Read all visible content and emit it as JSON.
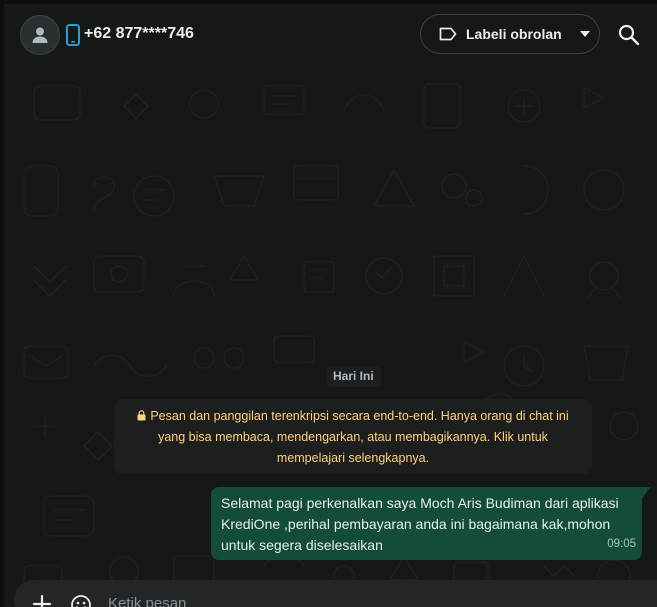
{
  "header": {
    "contact_name": "+62 877****746",
    "label_button": "Labeli obrolan"
  },
  "chat": {
    "date_chip": "Hari Ini",
    "encryption_notice": "Pesan dan panggilan terenkripsi secara end-to-end. Hanya orang di chat ini yang bisa membaca, mendengarkan, atau membagikannya. Klik untuk mempelajari selengkapnya.",
    "messages": [
      {
        "direction": "outgoing",
        "text": "Selamat pagi perkenalkan saya Moch Aris Budiman dari aplikasi KrediOne ,perihal pembayaran anda ini bagaimana kak,mohon untuk segera diselesaikan",
        "time": "09:05"
      }
    ]
  },
  "composer": {
    "placeholder": "Ketik pesan",
    "value": ""
  },
  "icons": {
    "avatar": "person-icon",
    "phone": "phone-icon",
    "label": "tag-icon",
    "dropdown": "chevron-down-icon",
    "search": "search-icon",
    "lock": "lock-icon",
    "attach": "plus-icon",
    "emoji": "emoji-icon"
  },
  "colors": {
    "background": "#161717",
    "outgoing_bubble": "#144d37",
    "notice_text": "#ffd279",
    "phone_icon": "#2d9cdb",
    "primary_text": "#e9edef"
  }
}
